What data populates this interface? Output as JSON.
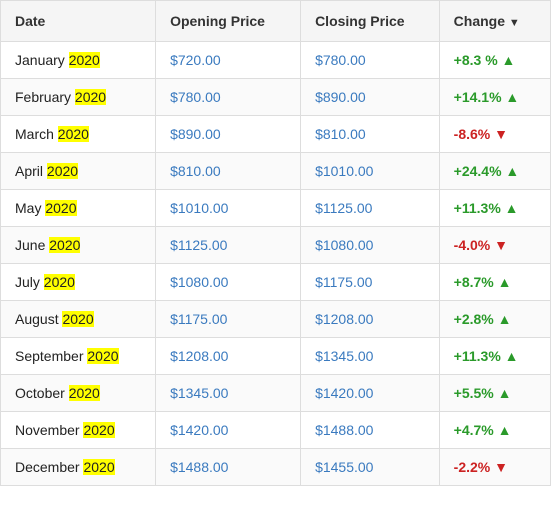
{
  "table": {
    "columns": [
      {
        "key": "date",
        "label": "Date"
      },
      {
        "key": "opening",
        "label": "Opening Price"
      },
      {
        "key": "closing",
        "label": "Closing Price"
      },
      {
        "key": "change",
        "label": "Change ▼"
      }
    ],
    "rows": [
      {
        "month": "January",
        "year": "2020",
        "opening": "$720.00",
        "closing": "$780.00",
        "change": "+8.3 %",
        "direction": "up"
      },
      {
        "month": "February",
        "year": "2020",
        "opening": "$780.00",
        "closing": "$890.00",
        "change": "+14.1%",
        "direction": "up"
      },
      {
        "month": "March",
        "year": "2020",
        "opening": "$890.00",
        "closing": "$810.00",
        "change": "-8.6%",
        "direction": "down"
      },
      {
        "month": "April",
        "year": "2020",
        "opening": "$810.00",
        "closing": "$1010.00",
        "change": "+24.4%",
        "direction": "up"
      },
      {
        "month": "May",
        "year": "2020",
        "opening": "$1010.00",
        "closing": "$1125.00",
        "change": "+11.3%",
        "direction": "up"
      },
      {
        "month": "June",
        "year": "2020",
        "opening": "$1125.00",
        "closing": "$1080.00",
        "change": "-4.0%",
        "direction": "down"
      },
      {
        "month": "July",
        "year": "2020",
        "opening": "$1080.00",
        "closing": "$1175.00",
        "change": "+8.7%",
        "direction": "up"
      },
      {
        "month": "August",
        "year": "2020",
        "opening": "$1175.00",
        "closing": "$1208.00",
        "change": "+2.8%",
        "direction": "up"
      },
      {
        "month": "September",
        "year": "2020",
        "opening": "$1208.00",
        "closing": "$1345.00",
        "change": "+11.3%",
        "direction": "up"
      },
      {
        "month": "October",
        "year": "2020",
        "opening": "$1345.00",
        "closing": "$1420.00",
        "change": "+5.5%",
        "direction": "up"
      },
      {
        "month": "November",
        "year": "2020",
        "opening": "$1420.00",
        "closing": "$1488.00",
        "change": "+4.7%",
        "direction": "up"
      },
      {
        "month": "December",
        "year": "2020",
        "opening": "$1488.00",
        "closing": "$1455.00",
        "change": "-2.2%",
        "direction": "down"
      }
    ]
  }
}
